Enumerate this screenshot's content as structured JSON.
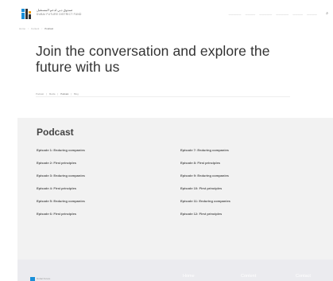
{
  "header": {
    "logo_ar": "صندوق دبي لدعم المستقبل",
    "logo_en": "DUBAI FUTURE DISTRICT FUND",
    "nav": [
      "—————",
      "————",
      "—————",
      "—————",
      "————",
      "————"
    ],
    "nav_end": "⌕"
  },
  "breadcrumb": [
    "Home",
    "Content",
    "Podcast"
  ],
  "hero": {
    "title": "Join the conversation and explore the future with us",
    "tags": [
      "Podcast",
      "Media",
      "Podcast",
      "Blog"
    ]
  },
  "podcast": {
    "title": "Podcast",
    "episodes_left": [
      "Episode 1: Enduring companies",
      "Episode 2: First principles",
      "Episode 3: Enduring companies",
      "Episode 4: First principles",
      "Episode 5: Enduring companies",
      "Episode 6: First principles"
    ],
    "episodes_right": [
      "Episode 7: Enduring companies",
      "Episode 8: First principles",
      "Episode 9: Enduring companies",
      "Episode 10: First principles",
      "Episode 11: Enduring companies",
      "Episode 12: First principles"
    ]
  },
  "footer": {
    "logo_text": "Dubai Future",
    "nav": [
      "Home",
      "Content",
      "Contact"
    ]
  },
  "colors": {
    "logo_blue": "#1a8fd8",
    "logo_orange": "#f39c12",
    "section_gray": "#f2f2f2",
    "footer_gray": "#ebebef"
  }
}
